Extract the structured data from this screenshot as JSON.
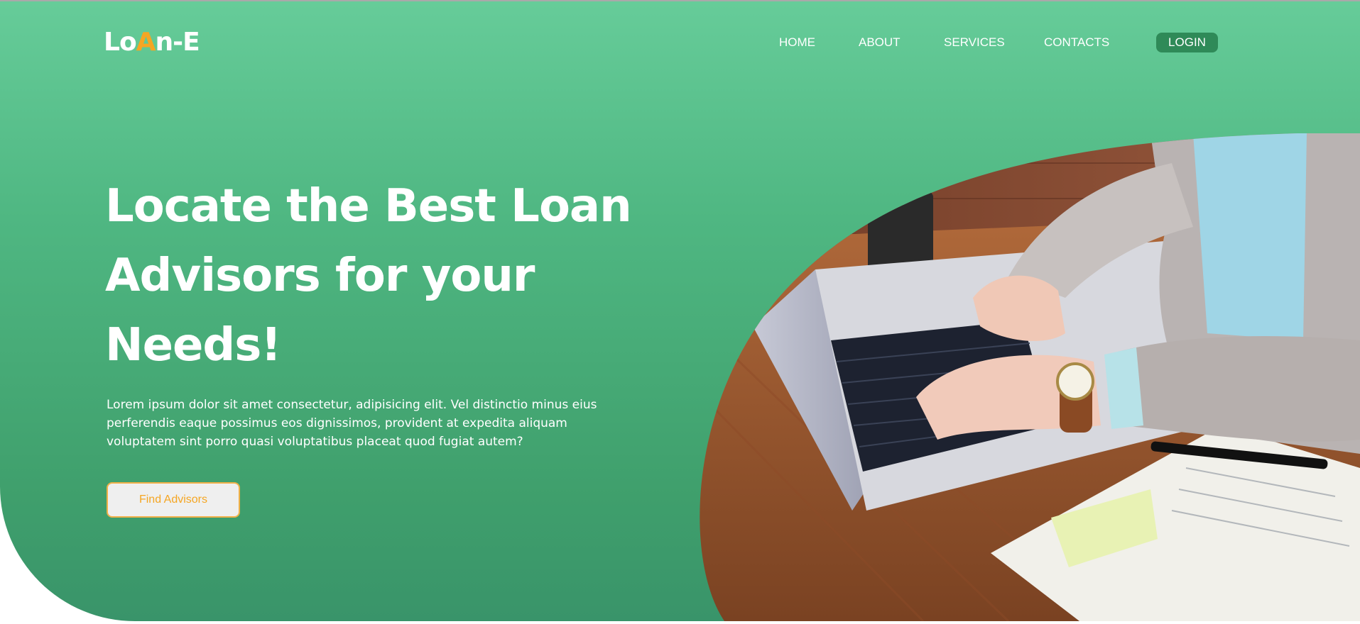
{
  "brand": {
    "logo_prefix": "Lo",
    "logo_accent": "A",
    "logo_suffix": "n-E",
    "accent_color": "#f5a623",
    "primary_color": "#4fb782"
  },
  "nav": {
    "items": [
      {
        "label": "HOME"
      },
      {
        "label": "ABOUT"
      },
      {
        "label": "SERVICES"
      },
      {
        "label": "CONTACTS"
      }
    ],
    "login_label": "LOGIN"
  },
  "hero": {
    "headline_line1": "Locate the Best Loan",
    "headline_line2": "Advisors for your",
    "headline_line3": "Needs!",
    "description": "Lorem ipsum dolor sit amet consectetur, adipisicing elit. Vel distinctio minus eius perferendis eaque possimus eos dignissimos, provident at expedita aliquam voluptatem sint porro quasi voluptatibus placeat quod fugiat autem?",
    "cta_label": "Find Advisors"
  },
  "image": {
    "subject": "person-typing-on-laptop"
  }
}
